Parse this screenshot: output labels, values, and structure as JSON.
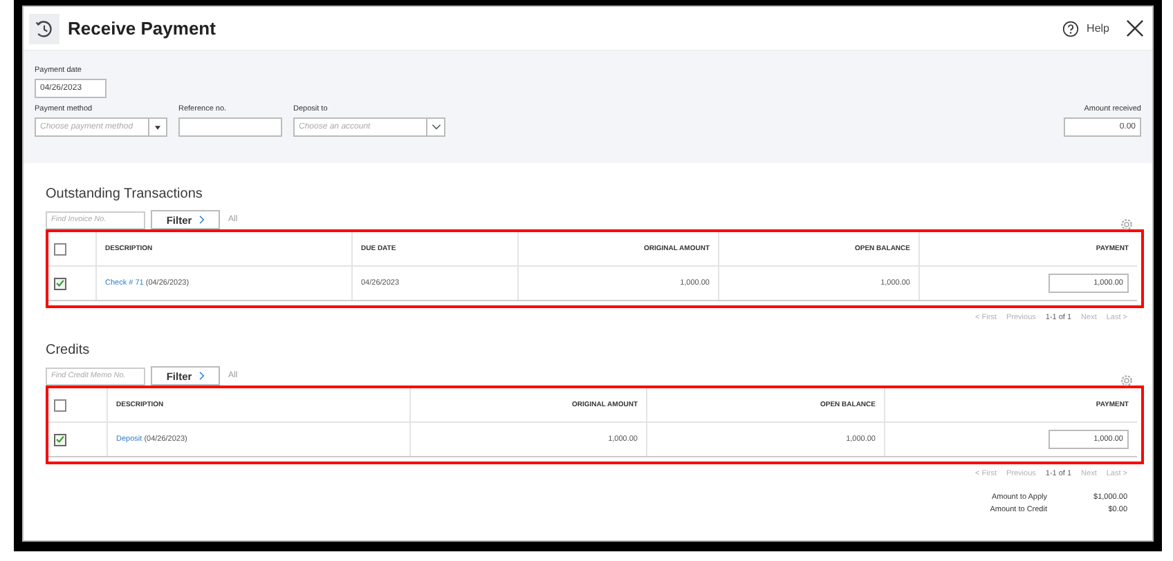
{
  "window": {
    "title": "Receive Payment",
    "help": "Help"
  },
  "form": {
    "payment_date": {
      "label": "Payment date",
      "value": "04/26/2023"
    },
    "payment_method": {
      "label": "Payment method",
      "placeholder": "Choose payment method"
    },
    "reference": {
      "label": "Reference no."
    },
    "deposit_to": {
      "label": "Deposit to",
      "placeholder": "Choose an account"
    },
    "amount_received": {
      "label": "Amount received",
      "value": "0.00"
    }
  },
  "sections": [
    {
      "title": "Outstanding Transactions",
      "search_placeholder": "Find Invoice No.",
      "filter": "Filter",
      "filter_value": "All",
      "highlighted": true,
      "header_checked": false,
      "columns": [
        {
          "kind": "description",
          "label": "DESCRIPTION"
        },
        {
          "kind": "date",
          "label": "DUE DATE"
        },
        {
          "kind": "amount",
          "label": "ORIGINAL AMOUNT"
        },
        {
          "kind": "amount",
          "label": "OPEN BALANCE"
        },
        {
          "kind": "payment",
          "label": "PAYMENT"
        }
      ],
      "rows": [
        {
          "checked": true,
          "link": "Check # 71",
          "date": "(04/26/2023)",
          "values": [
            "04/26/2023",
            "1,000.00",
            "1,000.00",
            "1,000.00"
          ]
        }
      ],
      "pagination": [
        {
          "label": "< First",
          "disabled": true
        },
        {
          "label": "Previous",
          "disabled": true
        },
        {
          "label": "1-1 of 1",
          "disabled": false
        },
        {
          "label": "Next",
          "disabled": true
        },
        {
          "label": "Last >",
          "disabled": true
        }
      ]
    },
    {
      "title": "Credits",
      "search_placeholder": "Find Credit Memo No.",
      "filter": "Filter",
      "filter_value": "All",
      "highlighted": true,
      "header_checked": false,
      "columns": [
        {
          "kind": "description",
          "label": "DESCRIPTION"
        },
        {
          "kind": "amount",
          "label": "ORIGINAL AMOUNT"
        },
        {
          "kind": "amount",
          "label": "OPEN BALANCE"
        },
        {
          "kind": "payment",
          "label": "PAYMENT"
        }
      ],
      "rows": [
        {
          "checked": true,
          "link": "Deposit",
          "date": "(04/26/2023)",
          "values": [
            "1,000.00",
            "1,000.00",
            "1,000.00"
          ]
        }
      ],
      "pagination": [
        {
          "label": "< First",
          "disabled": true
        },
        {
          "label": "Previous",
          "disabled": true
        },
        {
          "label": "1-1 of 1",
          "disabled": false
        },
        {
          "label": "Next",
          "disabled": true
        },
        {
          "label": "Last >",
          "disabled": true
        }
      ]
    }
  ],
  "summary": [
    {
      "label": "Amount to Apply",
      "value": "$1,000.00"
    },
    {
      "label": "Amount to Credit",
      "value": "$0.00"
    }
  ]
}
